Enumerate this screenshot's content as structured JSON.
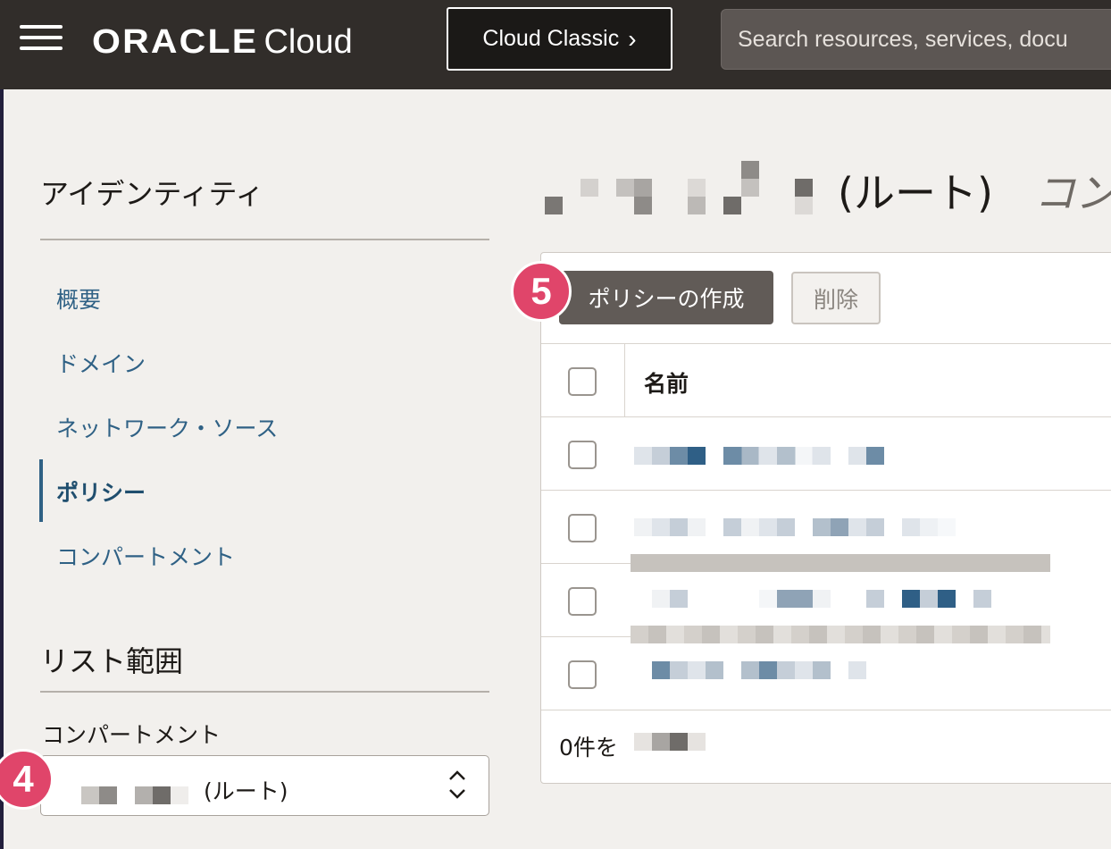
{
  "topbar": {
    "brand": "ORACLE",
    "product": "Cloud",
    "classic_button": "Cloud Classic",
    "classic_chevron": "›",
    "search_placeholder": "Search resources, services, docu",
    "menu_icon": "hamburger-menu-icon"
  },
  "sidebar": {
    "title": "アイデンティティ",
    "items": [
      {
        "label": "概要",
        "active": false
      },
      {
        "label": "ドメイン",
        "active": false
      },
      {
        "label": "ネットワーク・ソース",
        "active": false
      },
      {
        "label": "ポリシー",
        "active": true
      },
      {
        "label": "コンパートメント",
        "active": false
      }
    ],
    "scope_title": "リスト範囲",
    "compartment_label": "コンパートメント",
    "compartment_value": "(ルート)",
    "select_icon": "up-down-chevron-icon"
  },
  "badges": {
    "compartment": "4",
    "create": "5"
  },
  "main": {
    "title_suffix": "(ルート)",
    "title_trailing": "コン",
    "create_button": "ポリシーの作成",
    "delete_button": "削除",
    "table": {
      "column_name": "名前",
      "row_count_visible": 4
    },
    "footer_prefix": "0件を"
  },
  "colors": {
    "topbar": "#312d2a",
    "link": "#2f6185",
    "badge": "#e0456a",
    "primary_button": "#615b57"
  }
}
